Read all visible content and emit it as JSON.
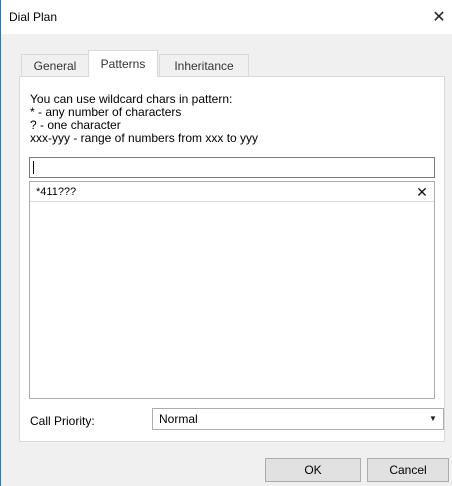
{
  "window": {
    "title": "Dial Plan",
    "close_glyph": "✕"
  },
  "tabs": [
    {
      "label": "General",
      "active": false
    },
    {
      "label": "Patterns",
      "active": true
    },
    {
      "label": "Inheritance",
      "active": false
    }
  ],
  "help": {
    "line1": "You can use wildcard chars in pattern:",
    "line2": "* - any number of characters",
    "line3": "? - one character",
    "line4": "xxx-yyy - range of numbers from xxx to yyy"
  },
  "pattern_input": {
    "value": ""
  },
  "patterns": [
    {
      "value": "*411???",
      "remove_glyph": "✕"
    }
  ],
  "call_priority": {
    "label": "Call Priority:",
    "value": "Normal",
    "arrow_glyph": "▼"
  },
  "buttons": {
    "ok": "OK",
    "cancel": "Cancel"
  }
}
